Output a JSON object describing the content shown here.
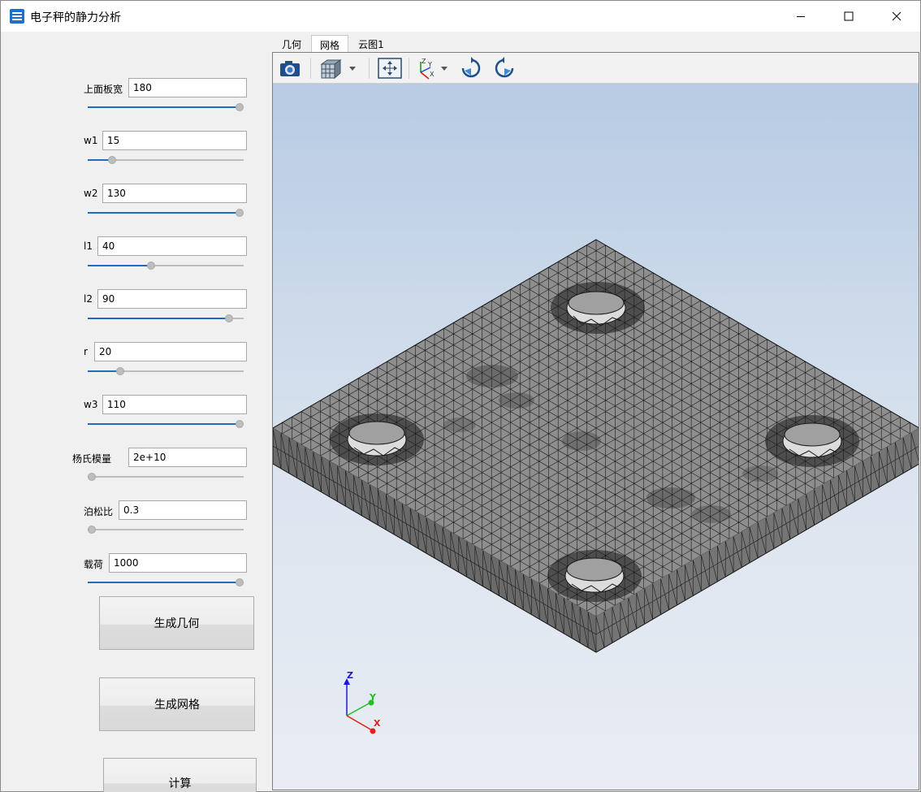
{
  "window": {
    "title": "电子秤的静力分析",
    "controls": {
      "minimize": "minimize-icon",
      "maximize": "maximize-icon",
      "close": "close-icon"
    }
  },
  "params": [
    {
      "label": "上面板宽",
      "value": "180",
      "slider_fraction": 1.0
    },
    {
      "label": "w1",
      "value": "15",
      "slider_fraction": 0.14
    },
    {
      "label": "w2",
      "value": "130",
      "slider_fraction": 1.0
    },
    {
      "label": "l1",
      "value": "40",
      "slider_fraction": 0.4
    },
    {
      "label": "l2",
      "value": "90",
      "slider_fraction": 0.93
    },
    {
      "label": "r",
      "value": "20",
      "slider_fraction": 0.19
    },
    {
      "label": "w3",
      "value": "110",
      "slider_fraction": 1.0
    },
    {
      "label": "杨氏模量",
      "value": "2e+10",
      "slider_fraction": 0.0
    },
    {
      "label": "泊松比",
      "value": "0.3",
      "slider_fraction": 0.0
    },
    {
      "label": "载荷",
      "value": "1000",
      "slider_fraction": 1.0
    }
  ],
  "buttons": {
    "generate_geometry": "生成几何",
    "generate_mesh": "生成网格",
    "compute": "计算"
  },
  "tabs": [
    {
      "label": "几何",
      "active": false
    },
    {
      "label": "网格",
      "active": true
    },
    {
      "label": "云图1",
      "active": false
    }
  ],
  "toolbar": {
    "icons": [
      "camera-icon",
      "display-mode-cube-icon",
      "dropdown-arrow-icon",
      "fit-all-icon",
      "view-axes-icon",
      "dropdown-arrow-icon",
      "rotate-clockwise-icon",
      "rotate-counterclockwise-icon"
    ]
  },
  "axis_triad": {
    "x": "X",
    "y": "Y",
    "z": "Z"
  },
  "colors": {
    "accent": "#1c6cc1",
    "mesh_fill": "#8e8e8e",
    "mesh_lines": "#1a1a1a",
    "viewport_top": "#b7cbe3",
    "viewport_bottom": "#e9edf3",
    "axis_x": "#e02020",
    "axis_y": "#20c020",
    "axis_z": "#1a1ad0"
  }
}
